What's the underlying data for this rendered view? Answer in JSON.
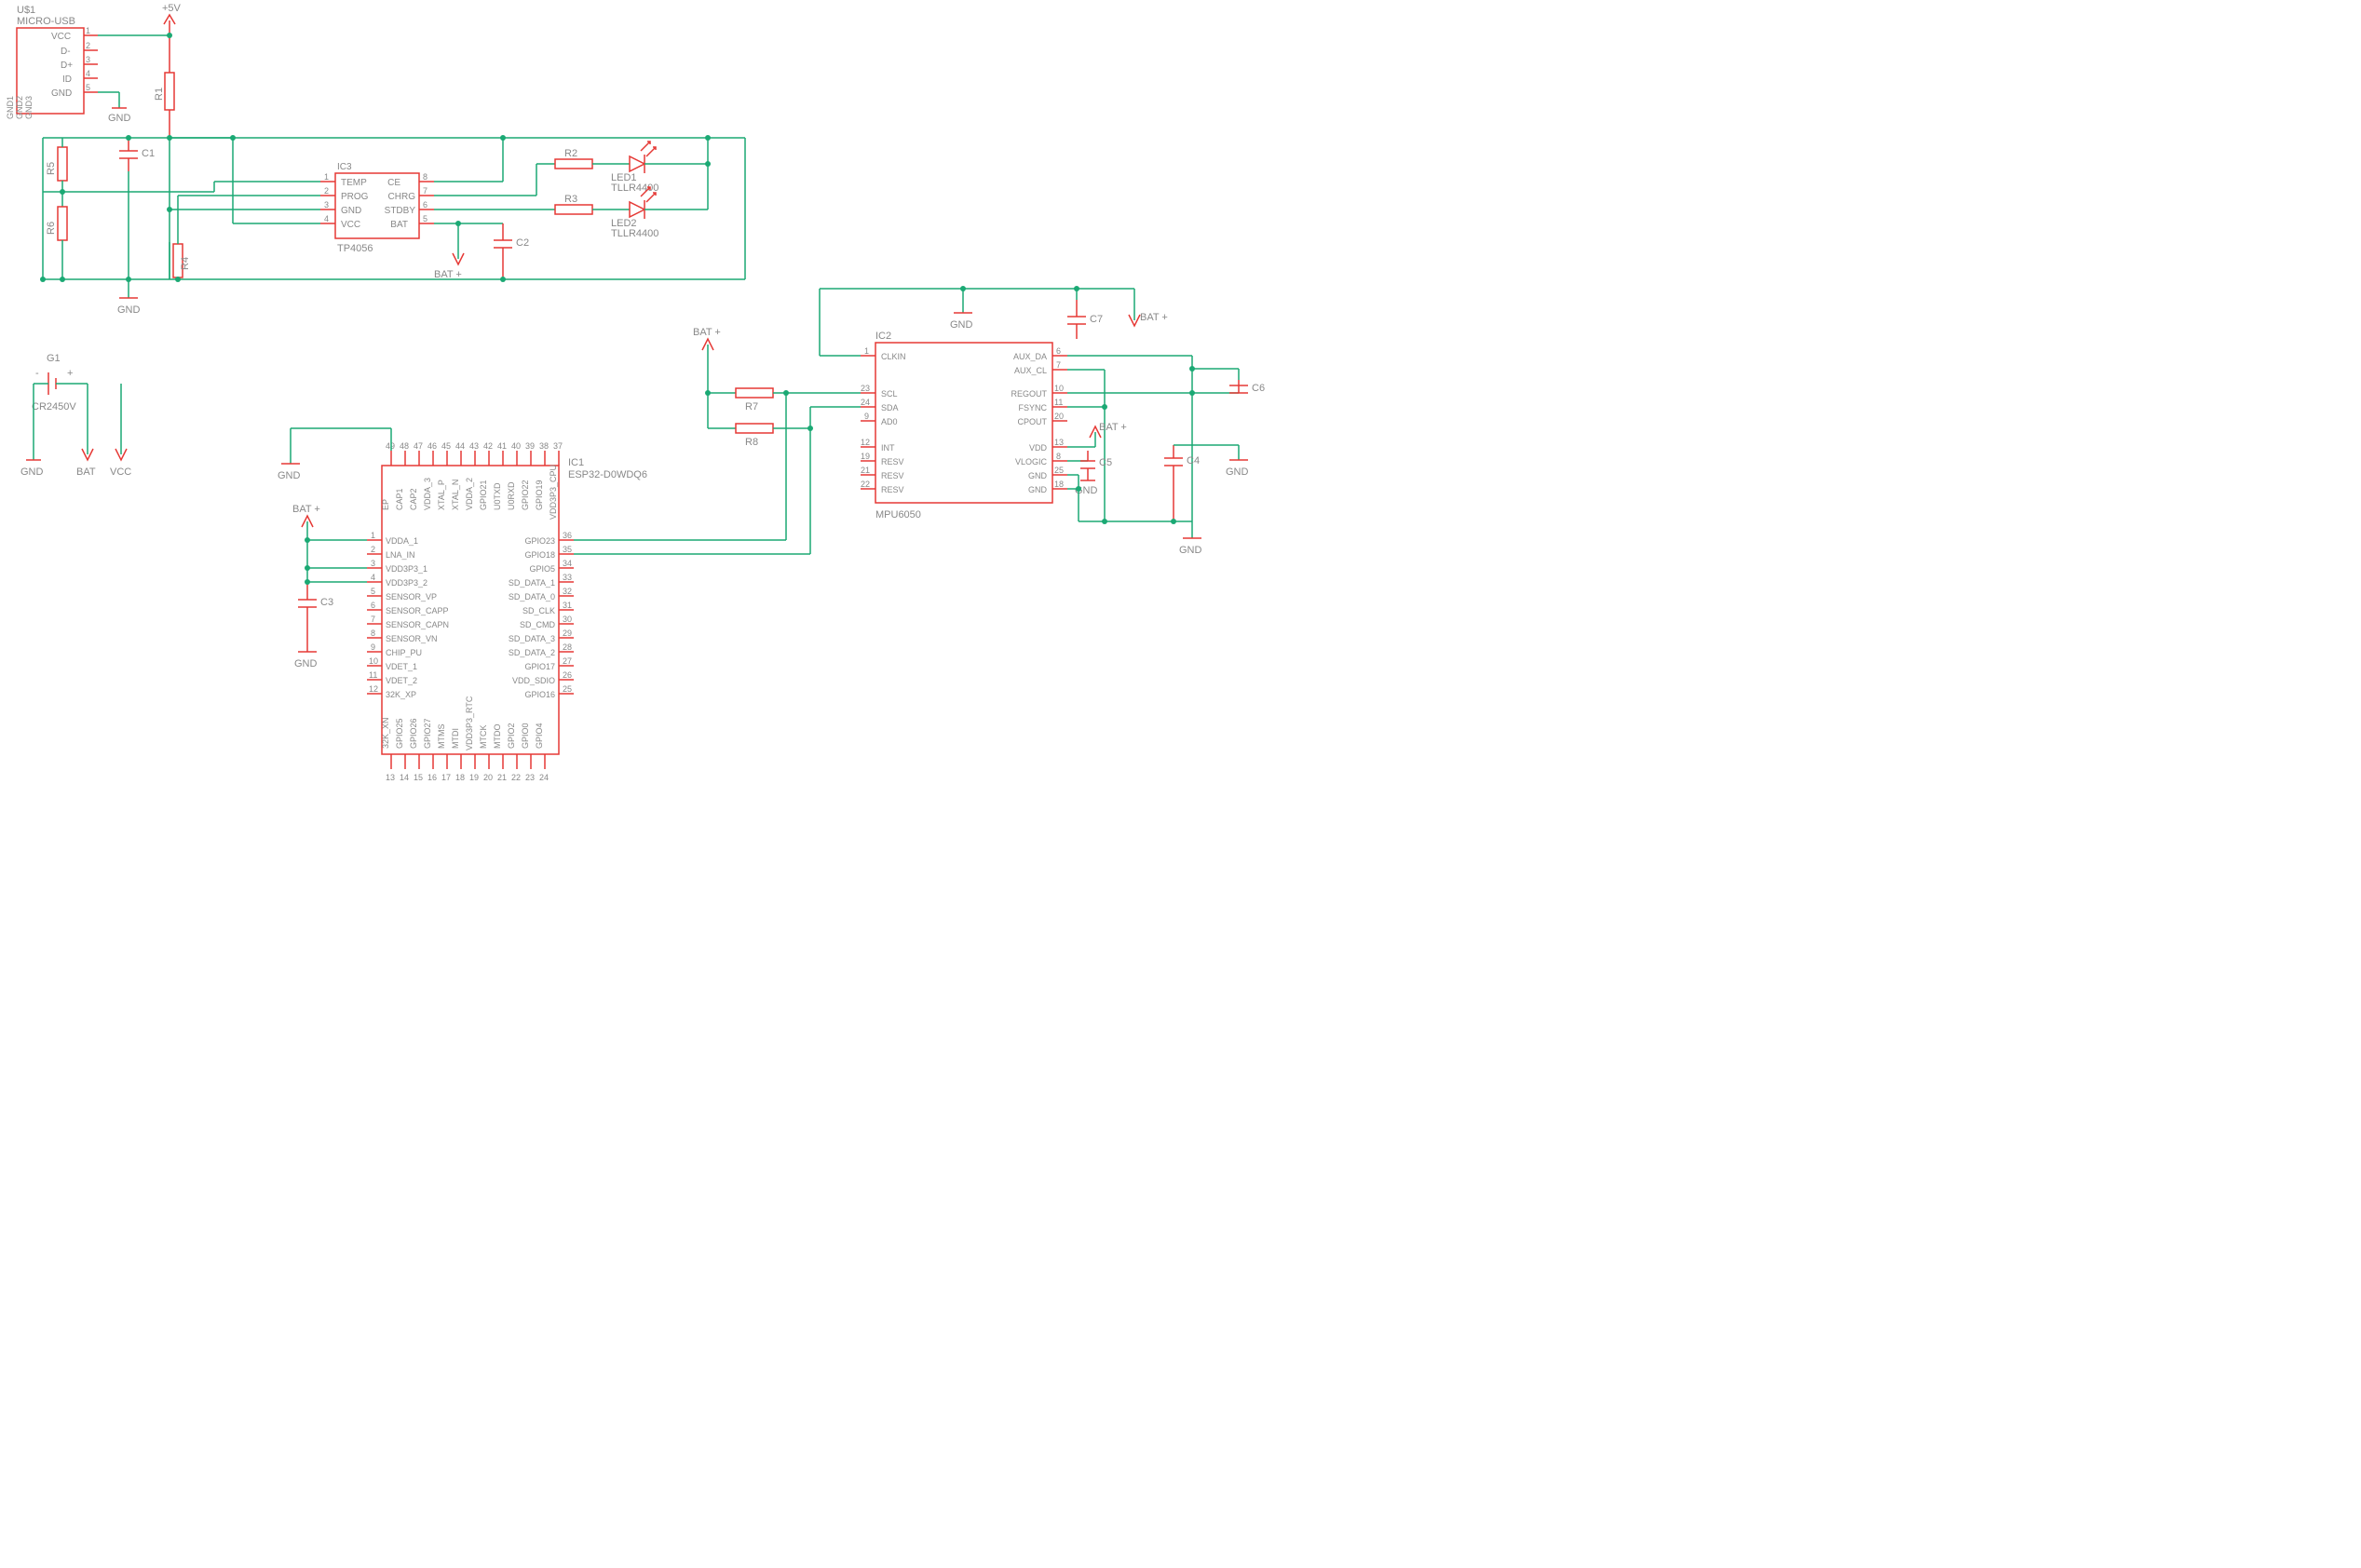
{
  "usb": {
    "ref": "U$1",
    "part": "MICRO-USB",
    "pins_left": [
      "VCC",
      "D-",
      "D+",
      "ID",
      "GND"
    ],
    "pins_bot": [
      "GND1",
      "GND2",
      "GND3"
    ],
    "nums": [
      "1",
      "2",
      "3",
      "4",
      "5"
    ]
  },
  "pwr": {
    "v5": "+5V",
    "gnd": "GND",
    "batp": "BAT +",
    "bat": "BAT",
    "vcc": "VCC"
  },
  "r": {
    "r1": "R1",
    "r2": "R2",
    "r3": "R3",
    "r4": "R4",
    "r5": "R5",
    "r6": "R6",
    "r7": "R7",
    "r8": "R8"
  },
  "c": {
    "c1": "C1",
    "c2": "C2",
    "c3": "C3",
    "c4": "C4",
    "c5": "C5",
    "c6": "C6",
    "c7": "C7"
  },
  "led": {
    "led1": "LED1",
    "led2": "LED2",
    "part": "TLLR4400"
  },
  "bat": {
    "ref": "G1",
    "part": "CR2450V",
    "plus": "+",
    "minus": "-"
  },
  "ic3": {
    "ref": "IC3",
    "part": "TP4056",
    "left": [
      "TEMP",
      "PROG",
      "GND",
      "VCC"
    ],
    "right": [
      "CE",
      "CHRG",
      "STDBY",
      "BAT"
    ],
    "lnums": [
      "1",
      "2",
      "3",
      "4"
    ],
    "rnums": [
      "8",
      "7",
      "6",
      "5"
    ]
  },
  "ic1": {
    "ref": "IC1",
    "part": "ESP32-D0WDQ6",
    "top": [
      "EP",
      "CAP1",
      "CAP2",
      "VDDA_3",
      "XTAL_P",
      "XTAL_N",
      "VDDA_2",
      "GPIO21",
      "U0TXD",
      "U0RXD",
      "GPIO22",
      "GPIO19",
      "VDD3P3_CPU"
    ],
    "topnums": [
      "49",
      "48",
      "47",
      "46",
      "45",
      "44",
      "43",
      "42",
      "41",
      "40",
      "39",
      "38",
      "37"
    ],
    "left": [
      "VDDA_1",
      "LNA_IN",
      "VDD3P3_1",
      "VDD3P3_2",
      "SENSOR_VP",
      "SENSOR_CAPP",
      "SENSOR_CAPN",
      "SENSOR_VN",
      "CHIP_PU",
      "VDET_1",
      "VDET_2",
      "32K_XP"
    ],
    "leftnums": [
      "1",
      "2",
      "3",
      "4",
      "5",
      "6",
      "7",
      "8",
      "9",
      "10",
      "11",
      "12"
    ],
    "right": [
      "GPIO23",
      "GPIO18",
      "GPIO5",
      "SD_DATA_1",
      "SD_DATA_0",
      "SD_CLK",
      "SD_CMD",
      "SD_DATA_3",
      "SD_DATA_2",
      "GPIO17",
      "VDD_SDIO",
      "GPIO16"
    ],
    "rightnums": [
      "36",
      "35",
      "34",
      "33",
      "32",
      "31",
      "30",
      "29",
      "28",
      "27",
      "26",
      "25"
    ],
    "bot": [
      "32K_XN",
      "GPIO25",
      "GPIO26",
      "GPIO27",
      "MTMS",
      "MTDI",
      "VDD3P3_RTC",
      "MTCK",
      "MTDO",
      "GPIO2",
      "GPIO0",
      "GPIO4"
    ],
    "botnums": [
      "13",
      "14",
      "15",
      "16",
      "17",
      "18",
      "19",
      "20",
      "21",
      "22",
      "23",
      "24"
    ]
  },
  "ic2": {
    "ref": "IC2",
    "part": "MPU6050",
    "left": [
      [
        "1",
        "CLKIN"
      ],
      [
        "23",
        "SCL"
      ],
      [
        "24",
        "SDA"
      ],
      [
        "9",
        "AD0"
      ],
      [
        "12",
        "INT"
      ],
      [
        "19",
        "RESV"
      ],
      [
        "21",
        "RESV"
      ],
      [
        "22",
        "RESV"
      ]
    ],
    "right": [
      [
        "6",
        "AUX_DA"
      ],
      [
        "7",
        "AUX_CL"
      ],
      [
        "10",
        "REGOUT"
      ],
      [
        "11",
        "FSYNC"
      ],
      [
        "20",
        "CPOUT"
      ],
      [
        "13",
        "VDD"
      ],
      [
        "8",
        "VLOGIC"
      ],
      [
        "25",
        "GND"
      ],
      [
        "18",
        "GND"
      ]
    ]
  }
}
